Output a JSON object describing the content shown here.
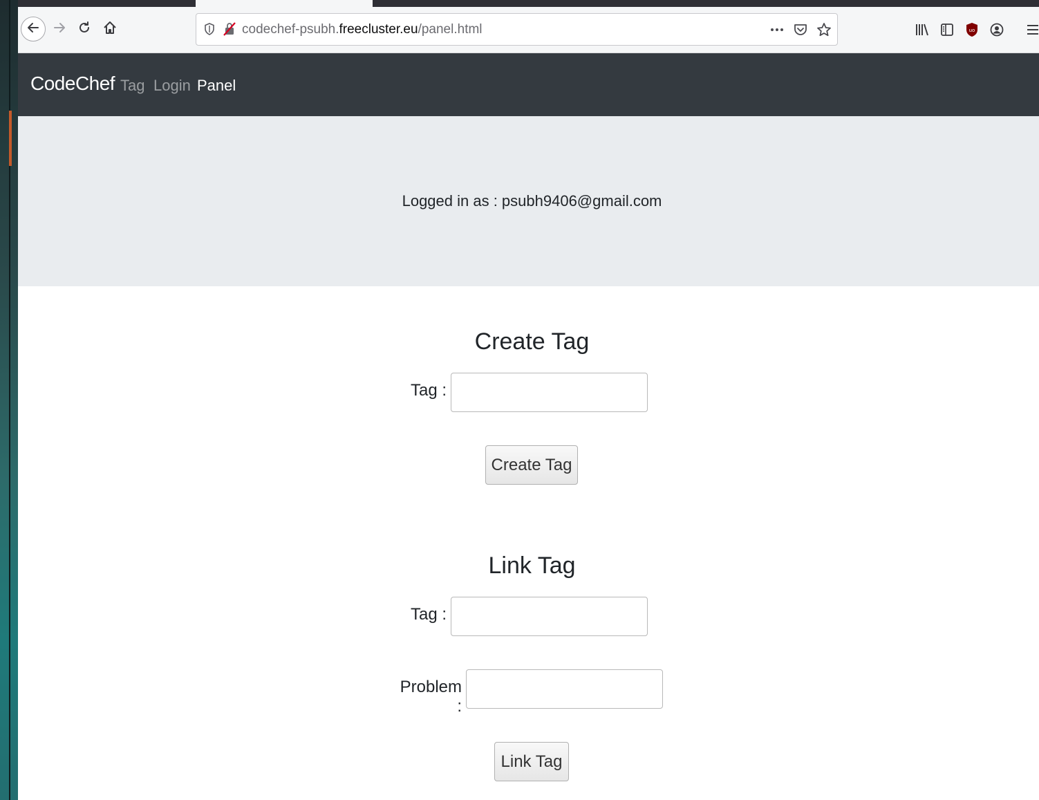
{
  "browser": {
    "url_prefix": "codechef-psubh.",
    "url_host": "freecluster.eu",
    "url_path": "/panel.html",
    "icons": {
      "back": "back-arrow-icon",
      "forward": "forward-arrow-icon",
      "reload": "reload-icon",
      "home": "home-icon",
      "tracking": "shield-icon",
      "insecure": "insecure-lock-icon",
      "more": "more-dots-icon",
      "pocket": "pocket-icon",
      "bookmark": "star-icon",
      "library": "library-icon",
      "sidebar": "sidebar-icon",
      "ublock": "ublock-icon",
      "account": "account-icon",
      "menu": "hamburger-menu-icon"
    }
  },
  "navbar": {
    "brand": "CodeChef",
    "links": [
      "Tag",
      "Login",
      "Panel"
    ],
    "active_link": "Panel"
  },
  "jumbotron": {
    "logged_in_text": "Logged in as : psubh9406@gmail.com"
  },
  "create_tag": {
    "title": "Create Tag",
    "tag_label": "Tag :",
    "tag_value": "",
    "button_label": "Create Tag"
  },
  "link_tag": {
    "title": "Link Tag",
    "tag_label": "Tag :",
    "tag_value": "",
    "problem_label": "Problem :",
    "problem_value": "",
    "button_label": "Link Tag"
  },
  "colors": {
    "navbar_bg": "#343a40",
    "jumbotron_bg": "#e9ecef",
    "text": "#212529"
  }
}
